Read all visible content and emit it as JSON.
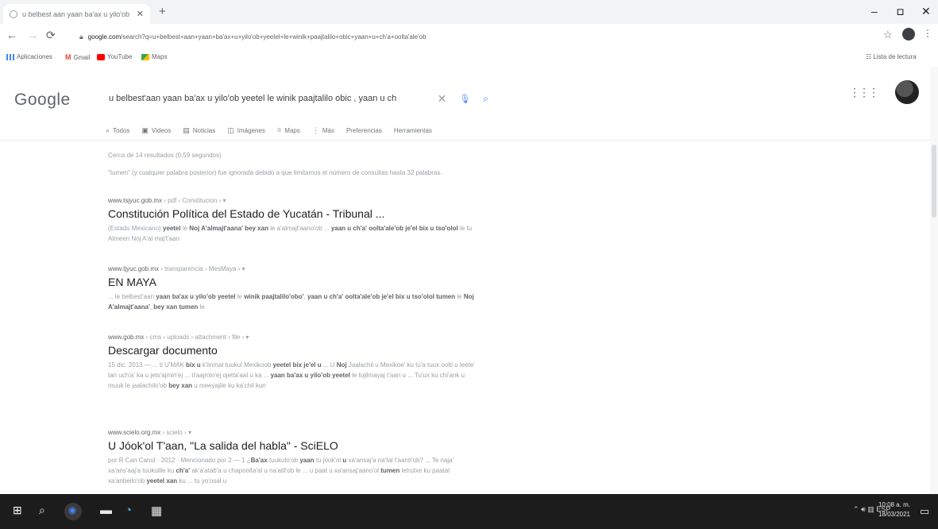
{
  "browser": {
    "tab_title": "u belbest aan yaan ba'ax u yilo'ob",
    "url_host": "google.com",
    "url_rest": "/search?q=u+belbest+aan+yaan+ba'ax+u+yilo'ob+yeetel+le+winik+paajtalilo+obic+yaan+u+ch'a+oolta'ale'ob",
    "reading_list": "Lista de lectura",
    "bookmarks": [
      {
        "label": "Aplicaciones",
        "icon": "apps-grid-icon",
        "color": "#4285f4"
      },
      {
        "label": "Gmail",
        "icon": "gmail-icon",
        "color": "#ea4335"
      },
      {
        "label": "YouTube",
        "icon": "youtube-icon",
        "color": "#ff0000"
      },
      {
        "label": "Maps",
        "icon": "maps-icon",
        "color": "#34a853"
      }
    ]
  },
  "google": {
    "logo": "Google",
    "query": "u belbest'aan yaan ba'ax u yilo'ob yeetel le winik paajtalilo obic , yaan u ch",
    "nav": [
      {
        "label": "Todos",
        "icon": "search-icon"
      },
      {
        "label": "Videos",
        "icon": "video-icon"
      },
      {
        "label": "Noticias",
        "icon": "news-icon"
      },
      {
        "label": "Imágenes",
        "icon": "images-icon"
      },
      {
        "label": "Maps",
        "icon": "map-pin-icon"
      },
      {
        "label": "Más",
        "icon": "more-icon"
      },
      {
        "label": "Preferencias",
        "icon": ""
      },
      {
        "label": "Herramientas",
        "icon": ""
      }
    ],
    "stats": "Cerca de 14 resultados (0,59 segundos)",
    "missing_note": "\"tumen\" (y cualquier palabra posterior) fue ignorada debido a que limitamos el número de consultas hasta 32 palabras."
  },
  "results": [
    {
      "url": "www.tsjyuc.gob.mx",
      "crumb": "› pdf › Constitucion ›",
      "title": "Constitución Política del Estado de Yucatán - Tribunal ...",
      "snippet": "(Estado Mexicano) <b>yeetel</b> le <b>Noj A'almajt'aana'</b> <b>bey xan</b> le a'almajt'aano'ob ... <b>yaan u ch'a' oolta'ale'ob je'el bix u tso'olol</b> le tu Almeen Noj A'al maj't'aan"
    },
    {
      "url": "www.tjyuc.gob.mx",
      "crumb": "› transparencia › MesMaya ›",
      "title": "EN MAYA",
      "snippet": "... le belbest'aan <b>yaan ba'ax u yilo'ob yeetel</b> le <b>winik paajtalilo'obo'</b>, <b>yaan u ch'a' oolta'ale'ob je'el bix u tso'olol tumen</b> le <b>Noj A'almajt'aana'</b>, <b>bey xan tumen</b> le"
    },
    {
      "url": "www.gob.mx",
      "crumb": "› cms › uploads › attachment › file ›",
      "title": "Descargar documento",
      "snippet": "15 dic. 2013 — ... ti U'MAK <b>bix u</b> k'iinmal tuukul Mexikoob <b>yeetel bix je'el u</b> ... U <b>Noj</b> Jaalachil u Mexikoe' ku tu'a tuux oolti u leete' tan uch'a' ka u jets'ajmin'ej ... ti'aajmin'ej ojetta'aal u ka ... <b>yaan ba'ax u yilo'ob yeetel</b> le tojilmayaj t'aan u ... Tu'ux ku chi'ank u muuk le jaalachilo'ob <b>bey xan</b> u meeyajile ku ka'chil kun"
    },
    {
      "url": "www.scielo.org.mx",
      "crumb": "› scielo ›",
      "title": "U Jóok'ol T'aan, \"La salida del habla\" - SciELO",
      "snippet": "por R Can Canul · 2012 · Mencionado por 2 — 1 ¿<b>Ba'ax</b> tuukulo'ob <b>yaan</b> tu jóok'ol <b>u</b> xa'ansaj'a na'tal t'aanti'ob? ... Te naja' xa'ans'aaj'a tuukulile ku <b>ch'a'</b> ak'a'atab'a u chapoolta'al u na'atil'ob le ... u paat u xa'ansaj'aano'ol <b>tumen</b> letrulxe ku paatal xa'anbeilo'ob <b>yeetel xan</b> ku ... tu yo'osal u"
    }
  ],
  "taskbar": {
    "lang": "ESP",
    "time": "10:08 a. m.",
    "date": "18/03/2021"
  }
}
